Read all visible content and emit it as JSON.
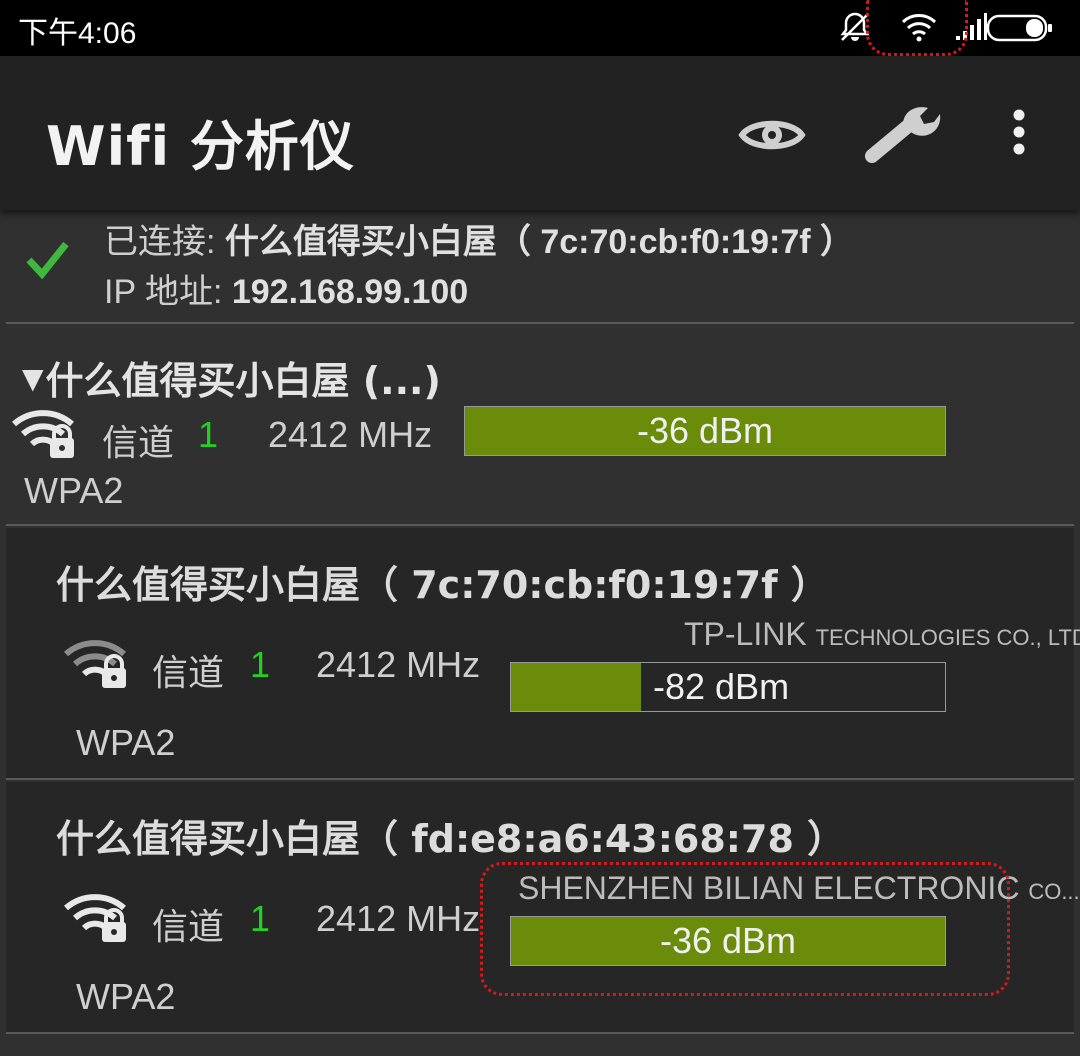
{
  "status_bar": {
    "time": "下午4:06"
  },
  "app_bar": {
    "title": "Wifi 分析仪"
  },
  "connected": {
    "label": "已连接:",
    "ssid": "什么值得买小白屋（ 7c:70:cb:f0:19:7f ）",
    "ip_label": "IP 地址:",
    "ip": "192.168.99.100"
  },
  "group": {
    "title": "什么值得买小白屋 (...)",
    "channel_label": "信道",
    "channel": "1",
    "frequency": "2412 MHz",
    "signal": "-36 dBm",
    "signal_fraction": 1.0,
    "security": "WPA2"
  },
  "networks": [
    {
      "title": "什么值得买小白屋（ 7c:70:cb:f0:19:7f ）",
      "vendor_main": "TP-LINK ",
      "vendor_small": "TECHNOLOGIES CO., LTD",
      "channel_label": "信道",
      "channel": "1",
      "frequency": "2412 MHz",
      "signal": "-82 dBm",
      "signal_fraction": 0.3,
      "security": "WPA2"
    },
    {
      "title": "什么值得买小白屋（ fd:e8:a6:43:68:78 ）",
      "vendor_main": "SHENZHEN BILIAN ELECTRONIC ",
      "vendor_small": "CO...",
      "channel_label": "信道",
      "channel": "1",
      "frequency": "2412 MHz",
      "signal": "-36 dBm",
      "signal_fraction": 1.0,
      "security": "WPA2"
    }
  ],
  "colors": {
    "channel": "#22d222",
    "bar_fill": "#6a8c0a",
    "callout": "#d41a1a"
  }
}
